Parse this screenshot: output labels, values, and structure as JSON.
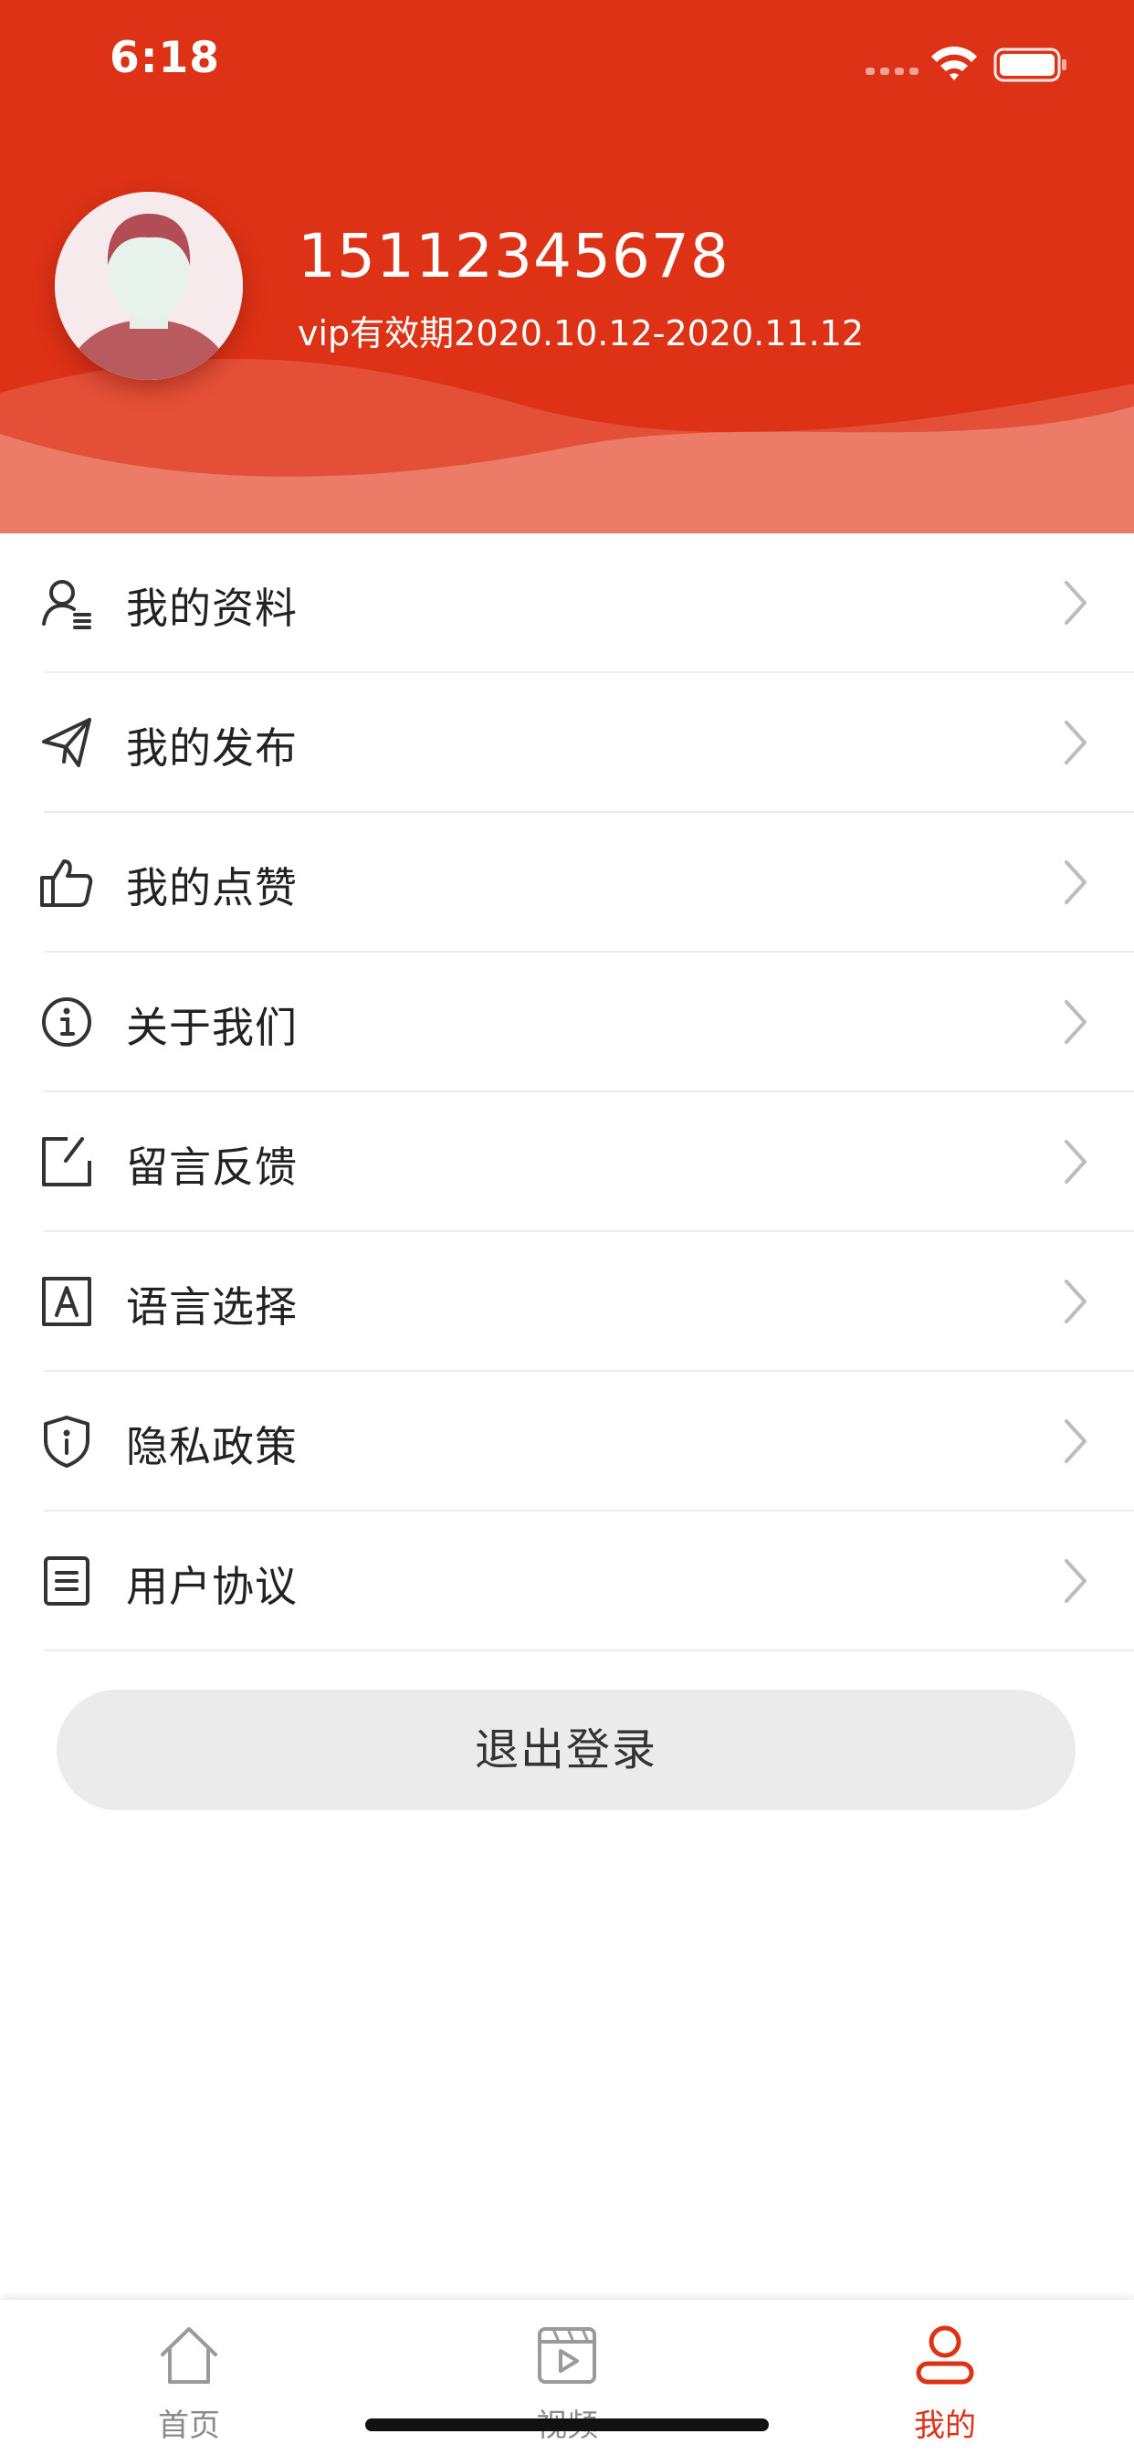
{
  "status_bar": {
    "time": "6:18"
  },
  "profile": {
    "phone": "15112345678",
    "vip_text": "vip有效期2020.10.12-2020.11.12"
  },
  "menu": {
    "items": [
      {
        "label": "我的资料",
        "icon": "user-profile-icon"
      },
      {
        "label": "我的发布",
        "icon": "paper-plane-icon"
      },
      {
        "label": "我的点赞",
        "icon": "thumbs-up-icon"
      },
      {
        "label": "关于我们",
        "icon": "info-icon"
      },
      {
        "label": "留言反馈",
        "icon": "edit-note-icon"
      },
      {
        "label": "语言选择",
        "icon": "letter-a-icon"
      },
      {
        "label": "隐私政策",
        "icon": "shield-icon"
      },
      {
        "label": "用户协议",
        "icon": "document-icon"
      }
    ]
  },
  "logout": {
    "label": "退出登录"
  },
  "tabbar": {
    "tabs": [
      {
        "label": "首页",
        "icon": "home-icon",
        "active": false
      },
      {
        "label": "视频",
        "icon": "video-icon",
        "active": false
      },
      {
        "label": "我的",
        "icon": "person-icon",
        "active": true
      }
    ]
  },
  "colors": {
    "brand_red": "#dd3216",
    "tab_inactive": "#8a8a8a",
    "menu_text": "#222222",
    "logout_bg": "#ebebeb"
  }
}
